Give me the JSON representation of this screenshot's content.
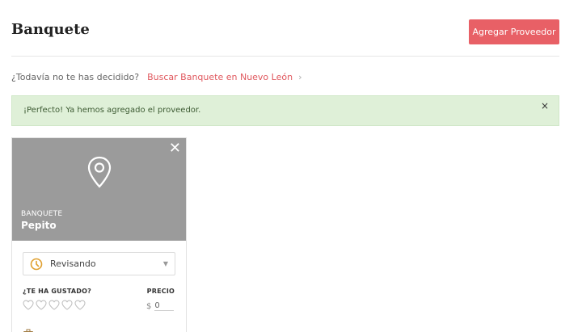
{
  "header": {
    "title": "Banquete",
    "add_button_label": "Agregar Proveedor"
  },
  "undecided": {
    "question": "¿Todavía no te has decidido?",
    "link_text": "Buscar Banquete en Nuevo León",
    "chevron": "›"
  },
  "alert": {
    "message": "¡Perfecto! Ya hemos agregado el proveedor.",
    "close_symbol": "×"
  },
  "card": {
    "close_symbol": "✕",
    "icon": "location-pin-icon",
    "category": "BANQUETE",
    "name": "Pepito",
    "status": {
      "value": "Revisando",
      "icon": "clock-icon"
    },
    "liked_label": "¿TE HA GUSTADO?",
    "rating": 0,
    "rating_max": 5,
    "price_label": "PRECIO",
    "currency": "$",
    "price_value": "0"
  },
  "colors": {
    "accent": "#e86066",
    "alert_bg": "#dff0d8",
    "card_header_bg": "#9b9b9b",
    "status_icon": "#e0a030"
  }
}
